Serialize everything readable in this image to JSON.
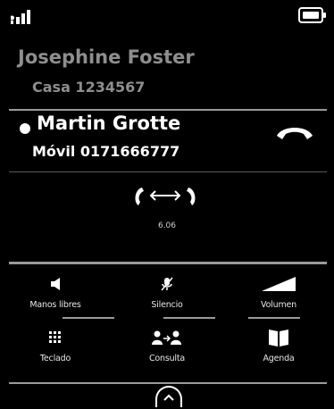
{
  "status_bar": {
    "signal_icon": "signal-icon",
    "battery_icon": "battery-icon"
  },
  "held_call": {
    "name": "Josephine Foster",
    "number": "Casa 1234567"
  },
  "active_call": {
    "name": "Martin Grotte",
    "number": "Móvil 0171666777",
    "end_icon": "end-call-icon"
  },
  "connection": {
    "icon": "call-transfer-icon",
    "timer": "6.06"
  },
  "buttons": [
    {
      "label": "Manos libres",
      "icon": "speaker-icon"
    },
    {
      "label": "Silencio",
      "icon": "mute-icon"
    },
    {
      "label": "Volumen",
      "icon": "volume-icon"
    },
    {
      "label": "Teclado",
      "icon": "keypad-icon"
    },
    {
      "label": "Consulta",
      "icon": "consult-icon"
    },
    {
      "label": "Agenda",
      "icon": "phonebook-icon"
    }
  ],
  "colors": {
    "background": "#000000",
    "held_text": "#8e8e8e",
    "active_text": "#ffffff",
    "divider": "#9a9a9a"
  }
}
